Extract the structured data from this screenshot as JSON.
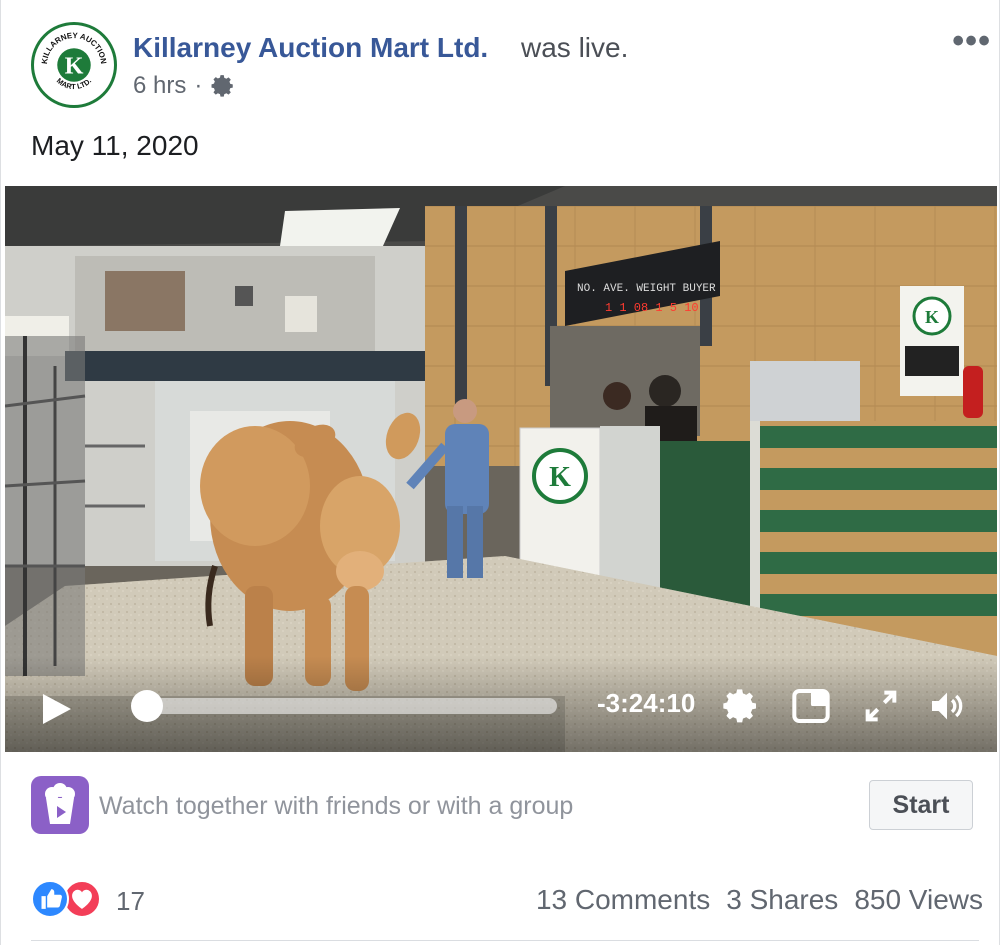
{
  "post": {
    "page_name": "Killarney Auction Mart Ltd.",
    "status_text": "was live.",
    "time_ago": "6 hrs",
    "separator": "·",
    "more_label": "•••",
    "text": "May 11, 2020"
  },
  "avatar": {
    "logo_top": "KILLARNEY AUCTION",
    "logo_bottom": "MART LTD.",
    "logo_letter": "K",
    "brand_color": "#1e7b3a"
  },
  "video": {
    "remaining_time": "-3:24:10",
    "progress_fraction": 0.0,
    "controls": [
      "play-icon",
      "gear-icon",
      "picture-in-picture-icon",
      "fullscreen-icon",
      "volume-icon"
    ],
    "scene_signage": {
      "board_text": "NO. AVE. WEIGHT  BUYER",
      "wall_sign_top": "Wall sign"
    }
  },
  "watch_party": {
    "text": "Watch together with friends or with a group",
    "button_label": "Start",
    "icon": "popcorn-play-icon",
    "accent": "#8b60c7"
  },
  "footer": {
    "reaction_count": "17",
    "comments": "13 Comments",
    "shares": "3 Shares",
    "views": "850 Views",
    "like_color": "#2d88ff",
    "love_color": "#f33e58"
  },
  "colors": {
    "link": "#385898",
    "secondary_text": "#616770"
  }
}
